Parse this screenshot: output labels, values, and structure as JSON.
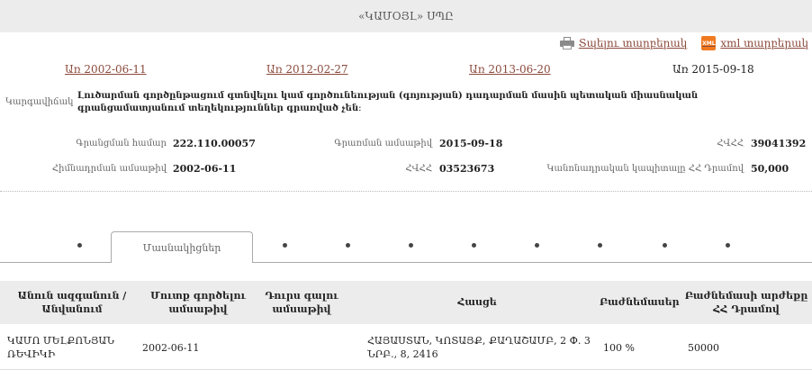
{
  "page": {
    "title": "«ԿԱՄՕՅԼ» ՍՊԸ"
  },
  "print": {
    "print_label": "Տպելու տարբերակ",
    "xml_label": "xml տարբերակ",
    "xml_icon_text": "XML"
  },
  "dates": {
    "d1": "Առ 2002-06-11",
    "d2": "Առ 2012-02-27",
    "d3": "Առ 2013-06-20",
    "current": "Առ 2015-09-18"
  },
  "status": {
    "label": "Կարգավիճակ",
    "value": "Լուծարման գործընթացում գտնվելու կամ գործունեության (գոյության) դադարման մասին պետական միասնական գրանցամատյանում տեղեկություններ գրառված չեն։"
  },
  "info": {
    "reg_num_label": "Գրանցման համար",
    "reg_num": "222.110.00057",
    "reg_date_label": "Գրառման ամսաթիվ",
    "reg_date": "2015-09-18",
    "tin_label": "ՀՎՀՀ",
    "tin": "39041392",
    "found_date_label": "Հիմնադրման ամսաթիվ",
    "found_date": "2002-06-11",
    "hvhh_label": "ՀՎՀՀ",
    "hvhh": "03523673",
    "capital_label": "Կանոնադրական կապիտալը ՀՀ Դրամով",
    "capital": "50,000"
  },
  "tabs": {
    "active": "Մասնակիցներ"
  },
  "table": {
    "headers": [
      "Անուն ազգանուն / Անվանում",
      "Մուտք գործելու ամսաթիվ",
      "Դուրս գալու ամսաթիվ",
      "Հասցե",
      "Բաժնեմասեր",
      "Բաժնեմասի արժեքը ՀՀ Դրամով"
    ],
    "rows": [
      {
        "name": "ԿԱՄՈ ՄԵԼՔՈՆՅԱՆ ՌԵՎԻԿԻ",
        "entry": "2002-06-11",
        "exit": "",
        "address": "ՀԱՅԱՍՏԱՆ, ԿՈՏԱՅՔ, ՔԱՂԱՇԱՄԲ, 2 Փ. 3 ՆՐԲ., 8, 2416",
        "share": "100 %",
        "value": "50000"
      }
    ]
  }
}
